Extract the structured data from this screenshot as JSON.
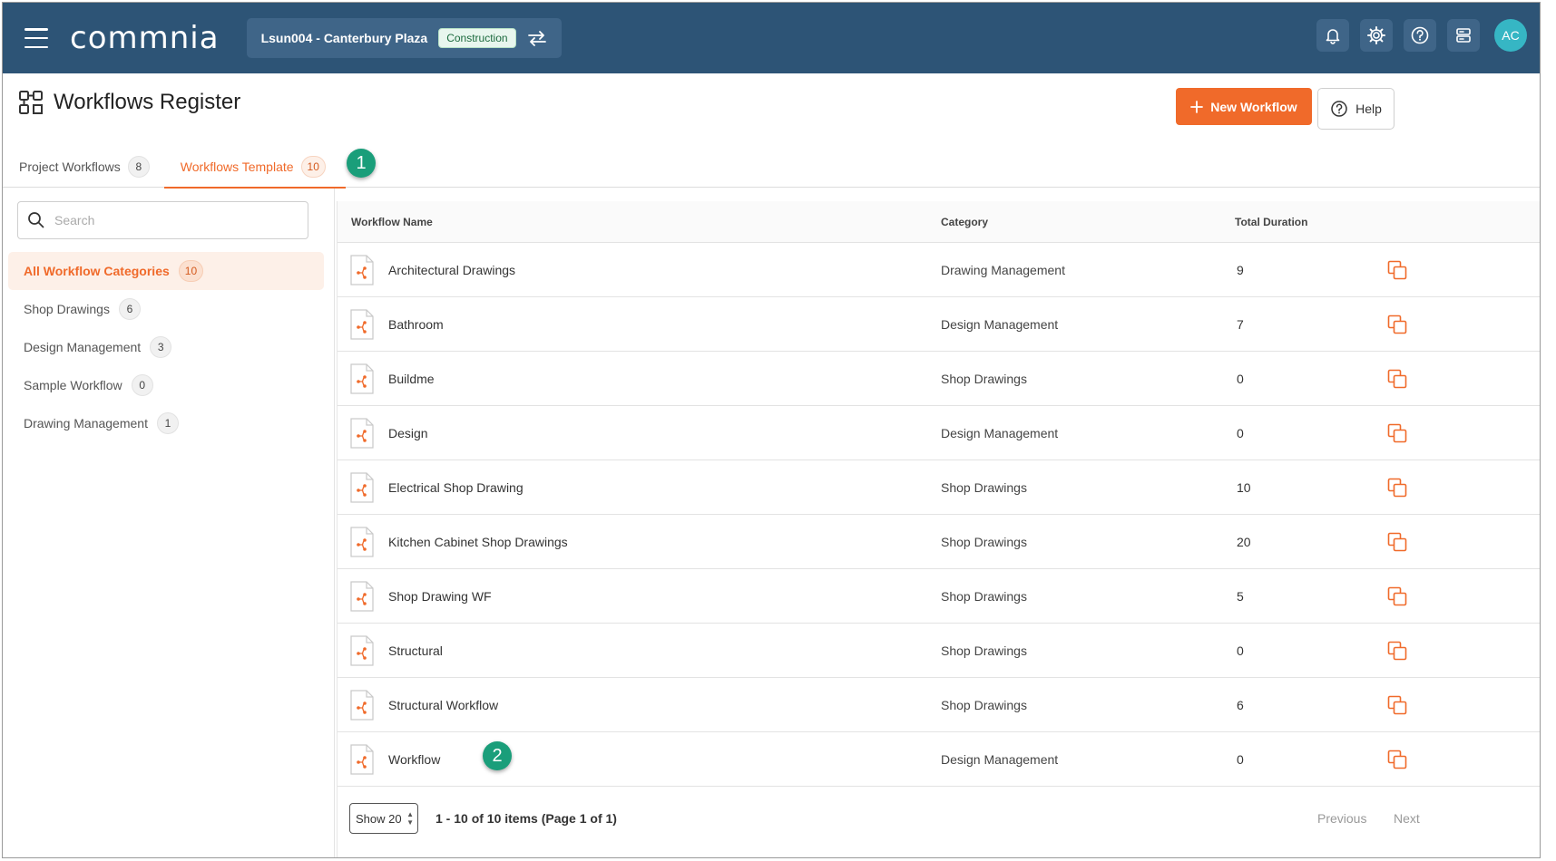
{
  "header": {
    "logo_text": "commnia",
    "project_name": "Lsun004 - Canterbury Plaza",
    "project_badge": "Construction",
    "avatar_initials": "AC"
  },
  "page": {
    "title": "Workflows Register",
    "new_button": "New Workflow",
    "help_button": "Help"
  },
  "tabs": [
    {
      "label": "Project Workflows",
      "count": "8",
      "active": false
    },
    {
      "label": "Workflows Template",
      "count": "10",
      "active": true
    }
  ],
  "markers": {
    "one": "1",
    "two": "2"
  },
  "search": {
    "placeholder": "Search"
  },
  "categories": [
    {
      "label": "All Workflow Categories",
      "count": "10"
    },
    {
      "label": "Shop Drawings",
      "count": "6"
    },
    {
      "label": "Design Management",
      "count": "3"
    },
    {
      "label": "Sample Workflow",
      "count": "0"
    },
    {
      "label": "Drawing Management",
      "count": "1"
    }
  ],
  "table": {
    "headers": {
      "name": "Workflow Name",
      "category": "Category",
      "duration": "Total Duration"
    },
    "rows": [
      {
        "name": "Architectural Drawings",
        "category": "Drawing Management",
        "duration": "9"
      },
      {
        "name": "Bathroom",
        "category": "Design Management",
        "duration": "7"
      },
      {
        "name": "Buildme",
        "category": "Shop Drawings",
        "duration": "0"
      },
      {
        "name": "Design",
        "category": "Design Management",
        "duration": "0"
      },
      {
        "name": "Electrical Shop Drawing",
        "category": "Shop Drawings",
        "duration": "10"
      },
      {
        "name": "Kitchen Cabinet Shop Drawings",
        "category": "Shop Drawings",
        "duration": "20"
      },
      {
        "name": "Shop Drawing WF",
        "category": "Shop Drawings",
        "duration": "5"
      },
      {
        "name": "Structural",
        "category": "Shop Drawings",
        "duration": "0"
      },
      {
        "name": "Structural Workflow",
        "category": "Shop Drawings",
        "duration": "6"
      },
      {
        "name": "Workflow",
        "category": "Design Management",
        "duration": "0"
      }
    ]
  },
  "pagination": {
    "show_label": "Show 20",
    "info": "1 - 10 of 10 items (Page 1 of 1)",
    "previous": "Previous",
    "next": "Next"
  },
  "colors": {
    "accent": "#f06a2a",
    "header_bg": "#2d5476",
    "marker": "#1a9e7a"
  }
}
